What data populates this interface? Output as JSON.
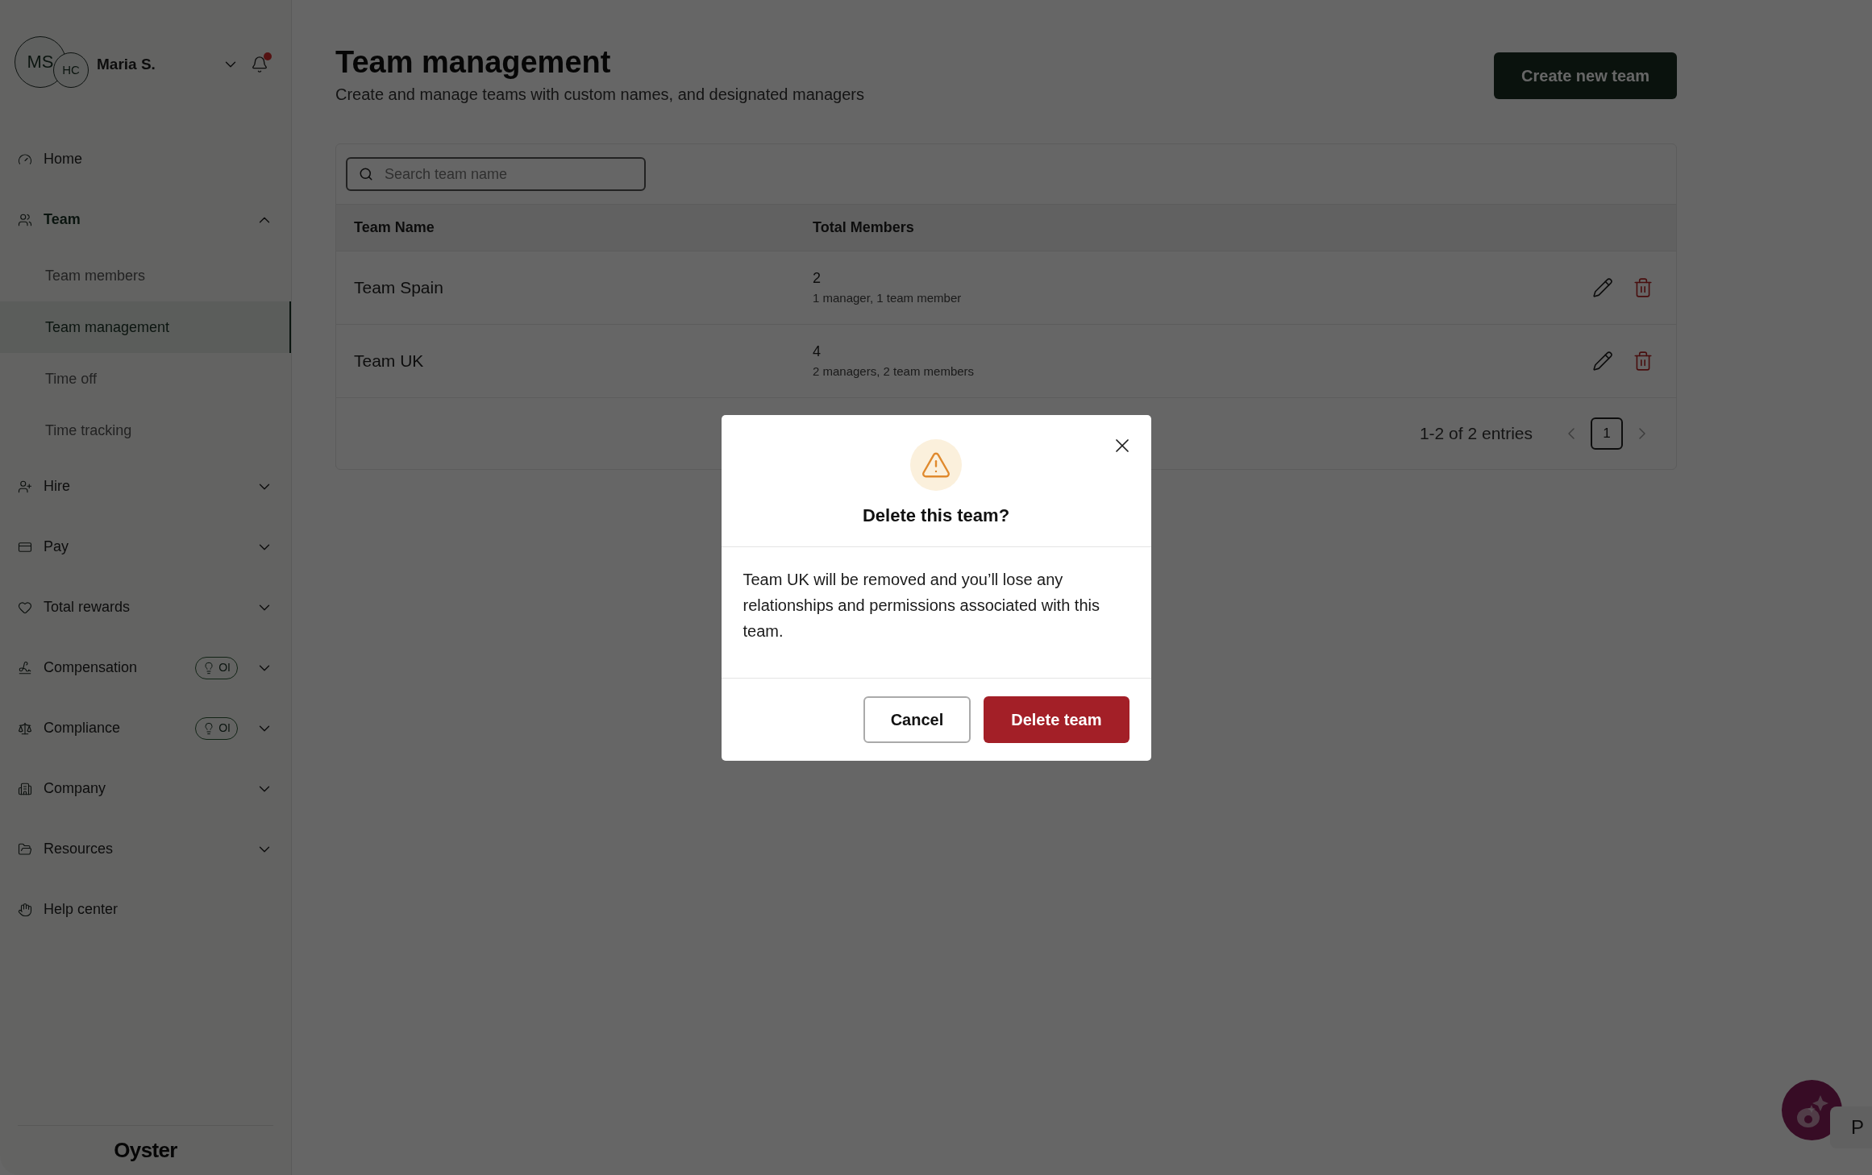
{
  "user": {
    "initials": "MS",
    "secondary_initials": "HC",
    "name": "Maria S.",
    "has_notification": true
  },
  "nav": [
    {
      "label": "Home"
    },
    {
      "label": "Team",
      "expanded": true,
      "children": [
        {
          "label": "Team members",
          "selected": false
        },
        {
          "label": "Team management",
          "selected": true
        },
        {
          "label": "Time off",
          "selected": false
        },
        {
          "label": "Time tracking",
          "selected": false
        }
      ]
    },
    {
      "label": "Hire",
      "expanded": false
    },
    {
      "label": "Pay",
      "expanded": false
    },
    {
      "label": "Total rewards",
      "expanded": false
    },
    {
      "label": "Compensation",
      "expanded": false,
      "badge": "OI"
    },
    {
      "label": "Compliance",
      "expanded": false,
      "badge": "OI"
    },
    {
      "label": "Company",
      "expanded": false
    },
    {
      "label": "Resources",
      "expanded": false
    },
    {
      "label": "Help center"
    }
  ],
  "logo": "Oyster",
  "page": {
    "title": "Team management",
    "subtitle": "Create and manage teams with custom names, and designated managers",
    "create_button": "Create new team"
  },
  "search": {
    "placeholder": "Search team name"
  },
  "table": {
    "columns": [
      "Team Name",
      "Total Members"
    ],
    "rows": [
      {
        "name": "Team Spain",
        "total": "2",
        "breakdown": "1 manager, 1 team member"
      },
      {
        "name": "Team UK",
        "total": "4",
        "breakdown": "2 managers, 2 team members"
      }
    ]
  },
  "pagination": {
    "summary": "1-2 of 2 entries",
    "pages": [
      {
        "label": "1",
        "selected": true
      }
    ]
  },
  "dialog": {
    "title": "Delete this team?",
    "message": "Team UK will be removed and you’ll lose any relationships and permissions associated with this team.",
    "buttons": [
      {
        "label": "Cancel",
        "kind": "secondary"
      },
      {
        "label": "Delete team",
        "kind": "danger"
      }
    ]
  },
  "tooltip": {
    "text": "P"
  }
}
